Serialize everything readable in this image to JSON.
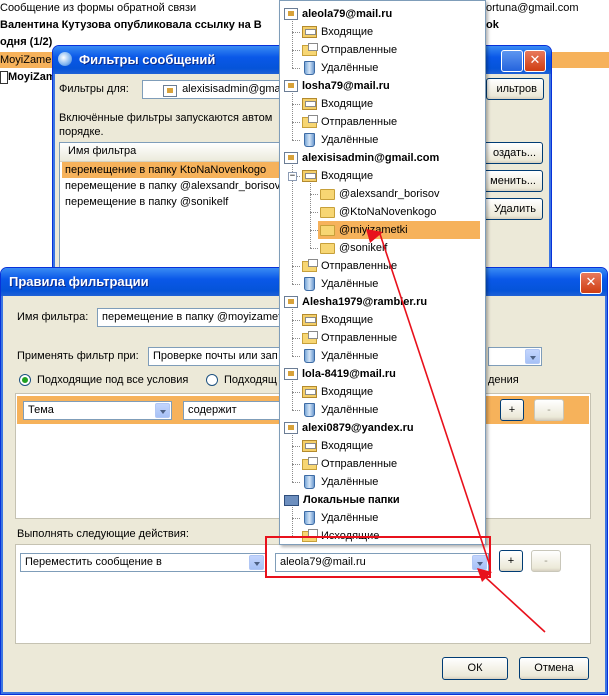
{
  "background_list": {
    "rows": [
      {
        "from": "Сообщение из формы обратной связи",
        "right": "ortuna@gmail.com"
      },
      {
        "from": "Валентина Кутузова опубликовала ссылку на В",
        "right": "ok"
      },
      {
        "from": "одня (1/2)",
        "right": ""
      },
      {
        "from": "MoyiZame",
        "right": ""
      },
      {
        "from": "MoyiZam",
        "right": ""
      }
    ]
  },
  "filters_window": {
    "title": "Фильтры сообщений",
    "filters_for_label": "Фильтры для:",
    "filters_for_value": "alexisisadmin@gmail.com",
    "filters_button": "ильтров",
    "description": "Включённые фильтры запускаются автом",
    "description2": "порядке.",
    "column_header": "Имя фильтра",
    "items": [
      "перемещение в папку KtoNaNovenkogo",
      "перемещение в папку @alexsandr_borisov",
      "перемещение в папку @sonikelf"
    ],
    "create_button": "оздать...",
    "edit_button": "менить...",
    "delete_button": "Удалить"
  },
  "rules_window": {
    "title": "Правила фильтрации",
    "filter_name_label": "Имя фильтра:",
    "filter_name_value": "перемещение в папку @moyizamet",
    "apply_label": "Применять фильтр при:",
    "apply_value": "Проверке почты или зап",
    "radio_all": "Подходящие под все условия",
    "radio_any": "Подходящ",
    "radio_tail": "дения",
    "condition_field": "Тема",
    "condition_op": "содержит",
    "plus": "+",
    "minus": "-",
    "actions_label": "Выполнять следующие действия:",
    "action_value": "Переместить сообщение в",
    "target_value": "aleola79@mail.ru",
    "ok_button": "ОК",
    "cancel_button": "Отмена"
  },
  "tree": {
    "nodes": [
      {
        "label": "aleola79@mail.ru",
        "kind": "account"
      },
      {
        "label": "Входящие",
        "kind": "inbox"
      },
      {
        "label": "Отправленные",
        "kind": "sent"
      },
      {
        "label": "Удалённые",
        "kind": "trash"
      },
      {
        "label": "losha79@mail.ru",
        "kind": "account"
      },
      {
        "label": "Входящие",
        "kind": "inbox"
      },
      {
        "label": "Отправленные",
        "kind": "sent"
      },
      {
        "label": "Удалённые",
        "kind": "trash"
      },
      {
        "label": "alexisisadmin@gmail.com",
        "kind": "account"
      },
      {
        "label": "Входящие",
        "kind": "inbox"
      },
      {
        "label": "@alexsandr_borisov",
        "kind": "folder"
      },
      {
        "label": "@KtoNaNovenkogo",
        "kind": "folder"
      },
      {
        "label": "@miyizametki",
        "kind": "folder"
      },
      {
        "label": "@sonikelf",
        "kind": "folder"
      },
      {
        "label": "Отправленные",
        "kind": "sent"
      },
      {
        "label": "Удалённые",
        "kind": "trash"
      },
      {
        "label": "Alesha1979@rambler.ru",
        "kind": "account"
      },
      {
        "label": "Входящие",
        "kind": "inbox"
      },
      {
        "label": "Отправленные",
        "kind": "sent"
      },
      {
        "label": "Удалённые",
        "kind": "trash"
      },
      {
        "label": "lola-8419@mail.ru",
        "kind": "account"
      },
      {
        "label": "Входящие",
        "kind": "inbox"
      },
      {
        "label": "Удалённые",
        "kind": "trash"
      },
      {
        "label": "alexi0879@yandex.ru",
        "kind": "account"
      },
      {
        "label": "Входящие",
        "kind": "inbox"
      },
      {
        "label": "Отправленные",
        "kind": "sent"
      },
      {
        "label": "Удалённые",
        "kind": "trash"
      },
      {
        "label": "Локальные папки",
        "kind": "local"
      },
      {
        "label": "Удалённые",
        "kind": "trash"
      },
      {
        "label": "Исходящие",
        "kind": "sent"
      }
    ],
    "selected_index": 12
  },
  "colors": {
    "selection": "#f6b25b",
    "annotation": "#e8111c",
    "xp_blue": "#0554d9"
  }
}
